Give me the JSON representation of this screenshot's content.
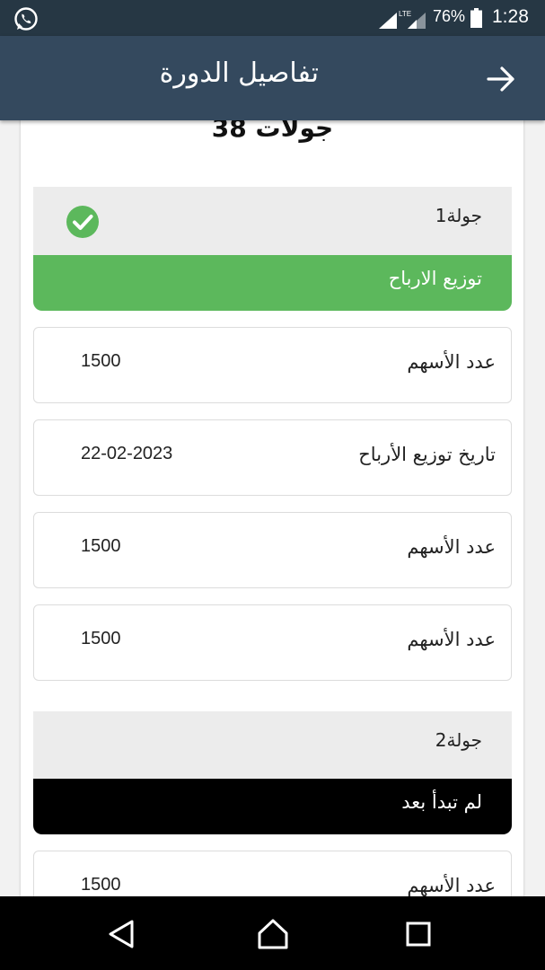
{
  "status_bar": {
    "network": "LTE",
    "battery": "76%",
    "time": "1:28"
  },
  "app_bar": {
    "title": "تفاصيل الدورة"
  },
  "summary": {
    "rounds_count": "جولات 38"
  },
  "rounds": [
    {
      "title": "جولة1",
      "status": "توزيع الارباح",
      "status_color": "#5cb85c",
      "completed": true,
      "rows": [
        {
          "label": "عدد الأسهم",
          "value": "1500"
        },
        {
          "label": "تاريخ توزيع الأرباح",
          "value": "22-02-2023"
        },
        {
          "label": "عدد الأسهم",
          "value": "1500"
        },
        {
          "label": "عدد الأسهم",
          "value": "1500"
        }
      ]
    },
    {
      "title": "جولة2",
      "status": "لم تبدأ بعد",
      "status_color": "#000000",
      "completed": false,
      "rows": [
        {
          "label": "عدد الأسهم",
          "value": "1500"
        }
      ]
    }
  ],
  "colors": {
    "status_bar_bg": "#263744",
    "app_bar_bg": "#34495e",
    "success": "#5cb85c"
  },
  "icons": {
    "whatsapp": "whatsapp-icon",
    "back": "arrow-right-icon",
    "check": "check-circle-icon",
    "nav_back": "triangle-back-icon",
    "nav_home": "home-icon",
    "nav_recents": "square-recents-icon"
  }
}
